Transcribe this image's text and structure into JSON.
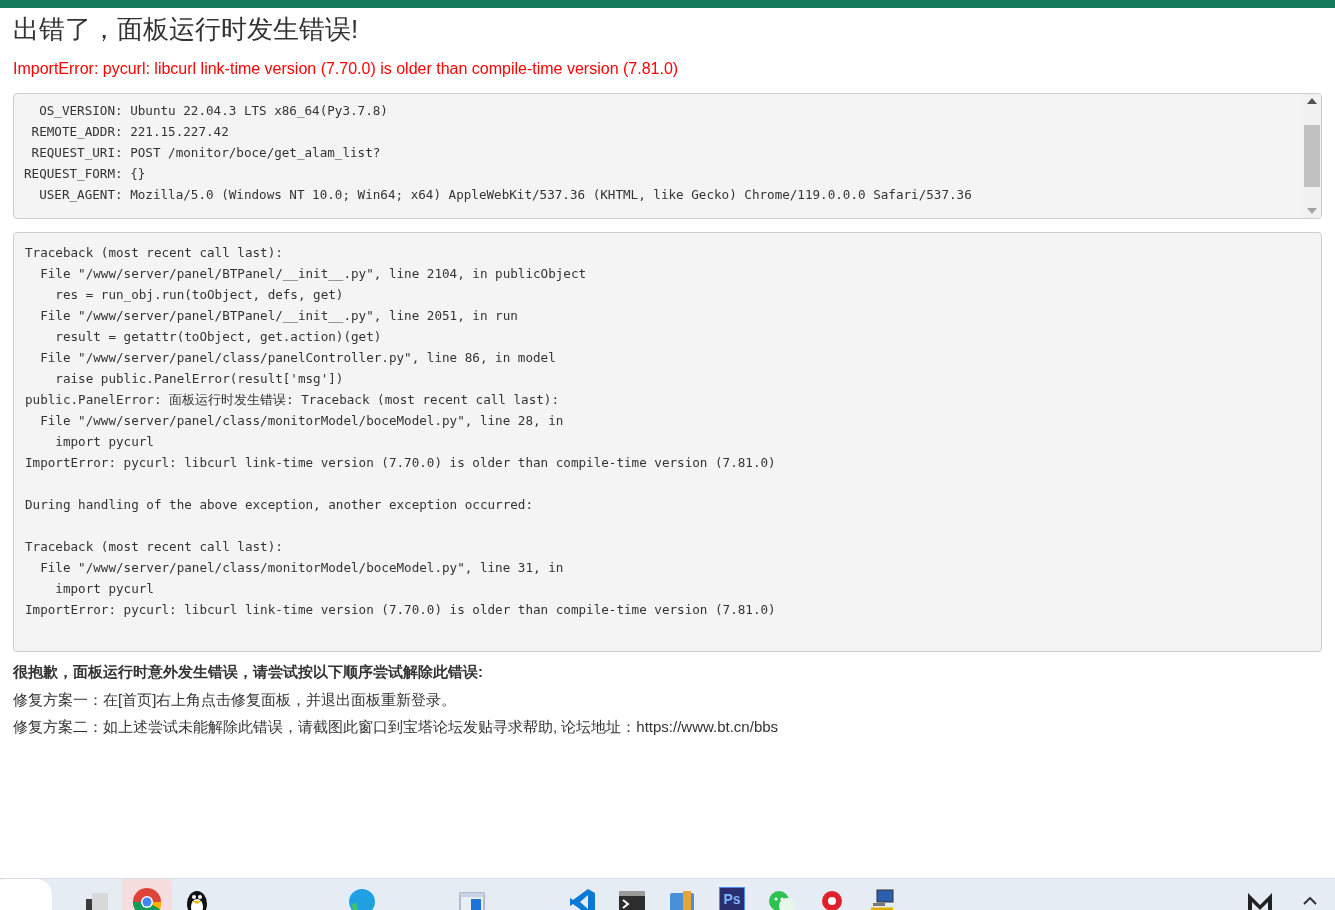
{
  "title": "出错了，面板运行时发生错误!",
  "error_message": "ImportError: pycurl: libcurl link-time version (7.70.0) is older than compile-time version (7.81.0)",
  "request_info": {
    "lines": [
      "  OS_VERSION: Ubuntu 22.04.3 LTS x86_64(Py3.7.8)",
      " REMOTE_ADDR: 221.15.227.42",
      " REQUEST_URI: POST /monitor/boce/get_alam_list?",
      "REQUEST_FORM: {}",
      "  USER_AGENT: Mozilla/5.0 (Windows NT 10.0; Win64; x64) AppleWebKit/537.36 (KHTML, like Gecko) Chrome/119.0.0.0 Safari/537.36"
    ]
  },
  "traceback": {
    "lines": [
      "Traceback (most recent call last):",
      "  File \"/www/server/panel/BTPanel/__init__.py\", line 2104, in publicObject",
      "    res = run_obj.run(toObject, defs, get)",
      "  File \"/www/server/panel/BTPanel/__init__.py\", line 2051, in run",
      "    result = getattr(toObject, get.action)(get)",
      "  File \"/www/server/panel/class/panelController.py\", line 86, in model",
      "    raise public.PanelError(result['msg'])",
      "public.PanelError: 面板运行时发生错误: Traceback (most recent call last):",
      "  File \"/www/server/panel/class/monitorModel/boceModel.py\", line 28, in",
      "    import pycurl",
      "ImportError: pycurl: libcurl link-time version (7.70.0) is older than compile-time version (7.81.0)",
      {
        "kind": "blank"
      },
      "During handling of the above exception, another exception occurred:",
      {
        "kind": "blank"
      },
      "Traceback (most recent call last):",
      "  File \"/www/server/panel/class/monitorModel/boceModel.py\", line 31, in",
      "    import pycurl",
      "ImportError: pycurl: libcurl link-time version (7.70.0) is older than compile-time version (7.81.0)",
      {
        "kind": "blank"
      }
    ]
  },
  "help": {
    "heading": "很抱歉，面板运行时意外发生错误，请尝试按以下顺序尝试解除此错误:",
    "steps": [
      "修复方案一：在[首页]右上角点击修复面板，并退出面板重新登录。",
      "修复方案二：如上述尝试未能解除此错误，请截图此窗口到宝塔论坛发贴寻求帮助, 论坛地址：https://www.bt.cn/bbs"
    ]
  },
  "taskbar": {
    "items": [
      {
        "kind": "search",
        "selected": false
      },
      {
        "kind": "desktop",
        "selected": false
      },
      {
        "kind": "chrome",
        "selected": true
      },
      {
        "kind": "penguin",
        "selected": false
      },
      {
        "kind": "edge",
        "selected": false
      },
      {
        "kind": "window",
        "selected": false
      },
      {
        "kind": "vscode",
        "selected": false
      },
      {
        "kind": "terminal",
        "selected": false
      },
      {
        "kind": "folder",
        "selected": false
      },
      {
        "kind": "photoshop",
        "label": "Ps",
        "selected": false
      },
      {
        "kind": "chat",
        "selected": false
      },
      {
        "kind": "redapp",
        "selected": false
      },
      {
        "kind": "network",
        "selected": false
      },
      {
        "kind": "mlogo",
        "selected": false
      },
      {
        "kind": "caret",
        "selected": false
      }
    ]
  }
}
